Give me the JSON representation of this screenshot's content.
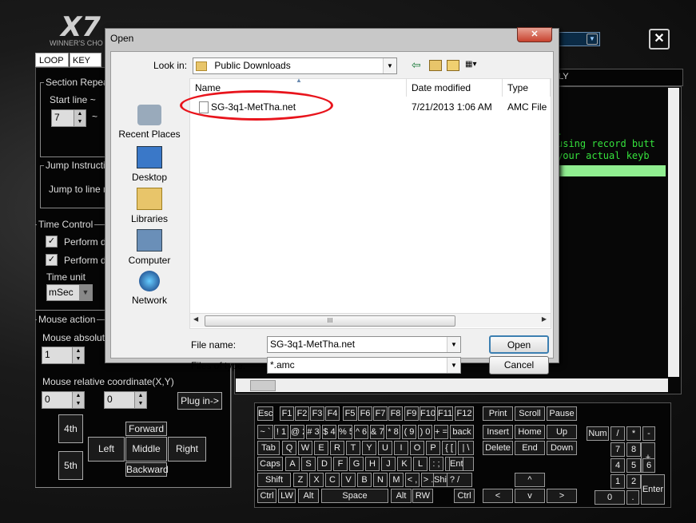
{
  "app": {
    "logo": "X7",
    "tagline": "WINNER'S CHO",
    "tabs": [
      "LOOP",
      "KEY"
    ],
    "close_glyph": "✕",
    "right_header_fragment": "LY",
    "green_text": [
      ".",
      "using record butt",
      "your actual keyb"
    ]
  },
  "left_panel": {
    "section_repeat": {
      "title": "Section Repeat",
      "start_line_label": "Start line  ~",
      "start_value": "7",
      "tilde": "~"
    },
    "jump": {
      "title": "Jump Instructio",
      "text": "Jump to line no"
    },
    "time_control": {
      "title": "Time Control",
      "perform1": "Perform de",
      "perform2": "Perform de",
      "time_unit_label": "Time unit",
      "time_unit_value": "mSec"
    },
    "mouse_action": {
      "title": "Mouse action",
      "absolute_label": "Mouse absolute",
      "absolute_value": "1",
      "relative_label": "Mouse relative coordinate(X,Y)",
      "x_value": "0",
      "y_value": "0",
      "plugin_label": "Plug in->",
      "buttons": {
        "b4": "4th",
        "b5": "5th",
        "forward": "Forward",
        "left": "Left",
        "middle": "Middle",
        "right": "Right",
        "backward": "Backward"
      }
    }
  },
  "keyboard": {
    "rows": [
      [
        "Esc",
        "F1",
        "F2",
        "F3",
        "F4",
        "F5",
        "F6",
        "F7",
        "F8",
        "F9",
        "F10",
        "F11",
        "F12"
      ],
      [
        "~ `",
        "! 1",
        "@ 2",
        "# 3",
        "$ 4",
        "% 5",
        "^ 6",
        "& 7",
        "* 8",
        "( 9",
        ") 0",
        "_ -",
        "+ =",
        "back"
      ],
      [
        "Tab",
        "Q",
        "W",
        "E",
        "R",
        "T",
        "Y",
        "U",
        "I",
        "O",
        "P",
        "{ [",
        "} ]",
        "| \\"
      ],
      [
        "Caps",
        "A",
        "S",
        "D",
        "F",
        "G",
        "H",
        "J",
        "K",
        "L",
        ": ;",
        "\" '",
        "Enter"
      ],
      [
        "Shift",
        "Z",
        "X",
        "C",
        "V",
        "B",
        "N",
        "M",
        "< ,",
        "> .",
        "? /",
        "Shift"
      ],
      [
        "Ctrl",
        "LW",
        "Alt",
        "Space",
        "Alt",
        "RW",
        "Ctrl"
      ]
    ],
    "nav": [
      "Print",
      "Scroll",
      "Pause",
      "Insert",
      "Home",
      "Up",
      "Delete",
      "End",
      "Down"
    ],
    "arrows": [
      "^",
      "<",
      "v",
      ">"
    ],
    "numpad": [
      "Num",
      "/",
      "*",
      "-",
      "7",
      "8",
      "9",
      "+",
      "4",
      "5",
      "6",
      "1",
      "2",
      "3",
      "Enter",
      "0",
      "."
    ]
  },
  "dialog": {
    "title": "Open",
    "look_in_label": "Look in:",
    "look_in_value": "Public Downloads",
    "places": [
      "Recent Places",
      "Desktop",
      "Libraries",
      "Computer",
      "Network"
    ],
    "columns": [
      "Name",
      "Date modified",
      "Type"
    ],
    "files": [
      {
        "name": "SG-3q1-MetTha.net",
        "date": "7/21/2013 1:06 AM",
        "type": "AMC File"
      }
    ],
    "file_name_label": "File name:",
    "file_name_value": "SG-3q1-MetTha.net",
    "file_type_label": "Files of type:",
    "file_type_value": "*.amc",
    "open_button": "Open",
    "cancel_button": "Cancel",
    "scroll_thumb": "III"
  },
  "colors": {
    "highlight": "#e8141c",
    "green": "#35e03c",
    "dialog_bg": "#f0f0f0"
  }
}
